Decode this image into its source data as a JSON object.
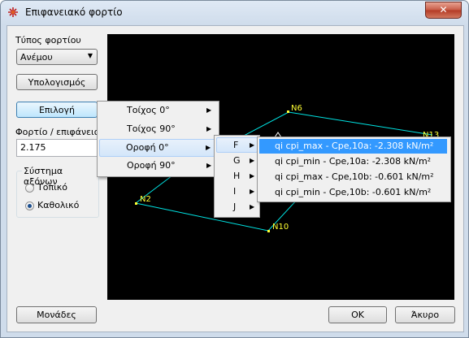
{
  "window": {
    "title": "Επιφανειακό φορτίο",
    "close_glyph": "✕"
  },
  "left_panel": {
    "load_type_label": "Τύπος φορτίου",
    "load_type_value": "Ανέμου",
    "calculate_button": "Υπολογισμός",
    "select_button": "Επιλογή",
    "load_surface_label": "Φορτίο / επιφάνεια",
    "load_surface_value": "2.175",
    "axes_group_title": "Σύστημα αξόνων",
    "radio_local": "Τοπικό",
    "radio_global": "Καθολικό",
    "radio_selected": "global"
  },
  "menu1": {
    "items": [
      "Τοίχος 0°",
      "Τοίχος 90°",
      "Οροφή 0°",
      "Οροφή 90°"
    ],
    "highlighted": "Οροφή 0°"
  },
  "menu2": {
    "items": [
      "F",
      "G",
      "H",
      "I",
      "J"
    ],
    "highlighted": "F"
  },
  "menu3": {
    "items": [
      "qi cpi_max - Cpe,10a: -2.308 kN/m²",
      "qi cpi_min - Cpe,10a: -2.308 kN/m²",
      "qi cpi_max - Cpe,10b: -0.601 kN/m²",
      "qi cpi_min - Cpe,10b: -0.601 kN/m²"
    ],
    "highlighted": "qi cpi_max - Cpe,10a: -2.308 kN/m²"
  },
  "canvas": {
    "nodes": [
      "N6",
      "N13",
      "N2",
      "N10"
    ],
    "colors": {
      "background": "#000000",
      "edges": "#00e5e5",
      "nodes": "#ffff33"
    }
  },
  "footer": {
    "units_button": "Μονάδες",
    "ok_button": "OK",
    "cancel_button": "Άκυρο"
  },
  "submenu_arrow": "▶",
  "dropdown_arrow": "▼"
}
